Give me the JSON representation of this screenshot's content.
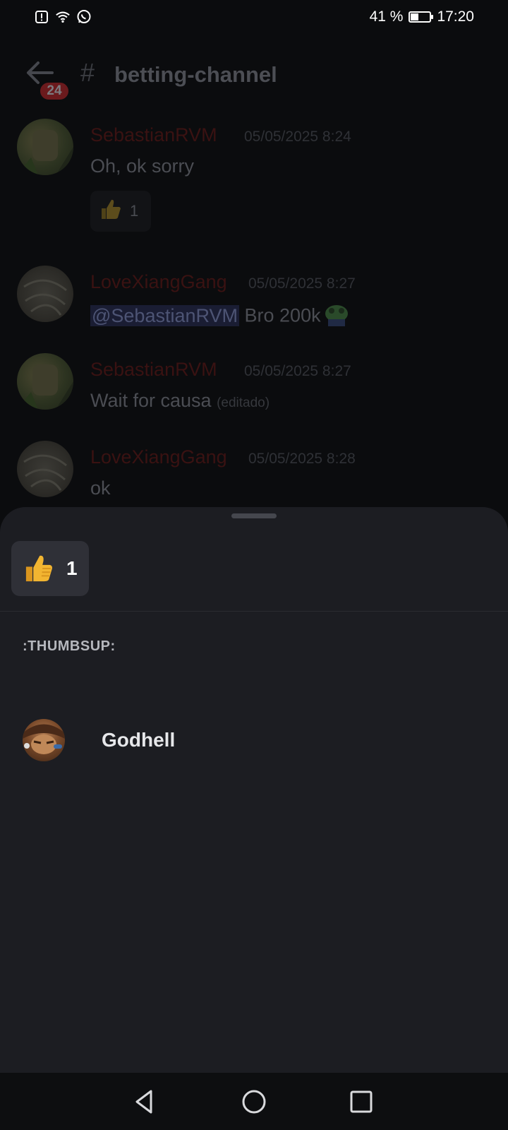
{
  "status_bar": {
    "battery_text": "41 %",
    "battery_level": 0.41,
    "time": "17:20",
    "icons": [
      "alert-icon",
      "wifi-icon",
      "whatsapp-icon"
    ]
  },
  "header": {
    "unread_count": "24",
    "hash": "#",
    "channel_name": "betting-channel"
  },
  "messages": [
    {
      "user": "SebastianRVM",
      "time": "05/05/2025 8:24",
      "text": "Oh, ok sorry",
      "reaction": {
        "emoji": "thumbsup",
        "count": "1"
      }
    },
    {
      "user": "LoveXiangGang",
      "time": "05/05/2025 8:27",
      "mention": "@SebastianRVM",
      "text": " Bro 200k"
    },
    {
      "user": "SebastianRVM",
      "time": "05/05/2025 8:27",
      "text": "Wait for causa",
      "edited": "(editado)"
    },
    {
      "user": "LoveXiangGang",
      "time": "05/05/2025 8:28",
      "text": "ok"
    }
  ],
  "sheet": {
    "reaction_count": "1",
    "section_label": ":THUMBSUP:",
    "users": [
      {
        "name": "Godhell"
      }
    ]
  },
  "colors": {
    "sheet_bg": "#1c1d22",
    "tab_bg": "#2f3037",
    "username_red": "#3a1212",
    "thumb_yellow": "#f2b531"
  }
}
